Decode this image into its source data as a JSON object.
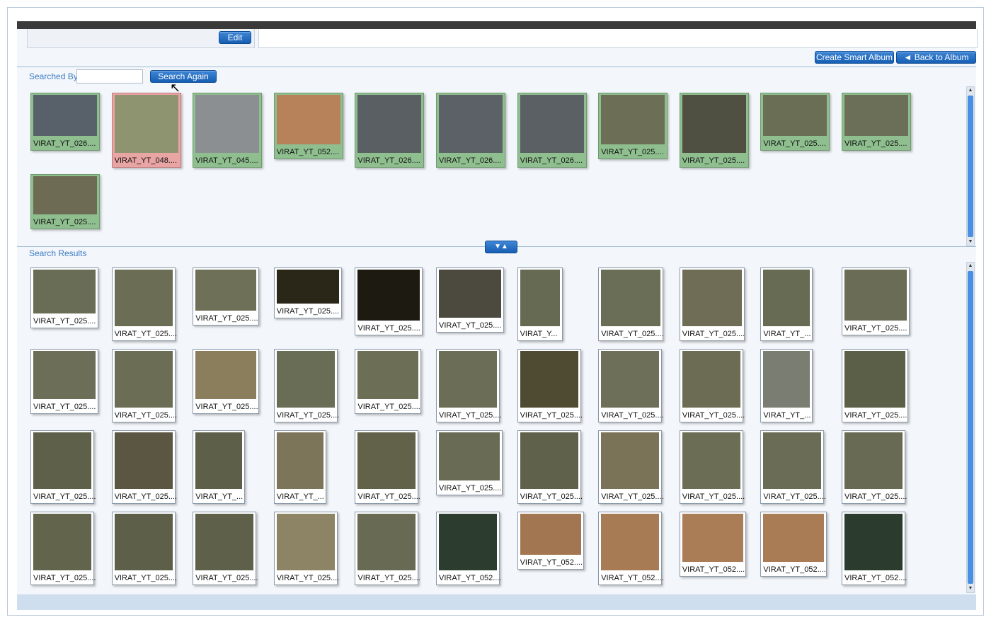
{
  "toolbar": {
    "edit_label": "Edit",
    "create_smart_album": "Create Smart Album",
    "back_to_album": "◄ Back to Album"
  },
  "search": {
    "searched_by_label": "Searched By",
    "searched_by_value": "",
    "search_again_label": "Search Again"
  },
  "query_tiles": [
    {
      "caption": "VIRAT_YT_026....",
      "style": "green",
      "color": "#58616a"
    },
    {
      "caption": "VIRAT_YT_048....",
      "style": "red",
      "color": "#8e9470"
    },
    {
      "caption": "VIRAT_YT_045....",
      "style": "green",
      "color": "#8b8f92"
    },
    {
      "caption": "VIRAT_YT_052....",
      "style": "green",
      "color": "#b7825a"
    },
    {
      "caption": "VIRAT_YT_026....",
      "style": "green",
      "color": "#595f63"
    },
    {
      "caption": "VIRAT_YT_026....",
      "style": "green",
      "color": "#5b6166"
    },
    {
      "caption": "VIRAT_YT_026....",
      "style": "green",
      "color": "#5a6063"
    },
    {
      "caption": "VIRAT_YT_025....",
      "style": "green",
      "color": "#6c6e56"
    },
    {
      "caption": "VIRAT_YT_025....",
      "style": "green",
      "color": "#4f5042"
    },
    {
      "caption": "VIRAT_YT_025....",
      "style": "green",
      "color": "#6a6e55"
    },
    {
      "caption": "VIRAT_YT_025....",
      "style": "green",
      "color": "#6b6f57"
    },
    {
      "caption": "VIRAT_YT_025....",
      "style": "green",
      "color": "#6d6b54"
    }
  ],
  "results": {
    "label": "Search Results",
    "rows": [
      [
        {
          "caption": "VIRAT_YT_025....",
          "color": "#6a6d55"
        },
        {
          "caption": "VIRAT_YT_025....",
          "color": "#6b6e55"
        },
        {
          "caption": "VIRAT_YT_025....",
          "color": "#6e7058"
        },
        {
          "caption": "VIRAT_YT_025....",
          "color": "#2a2618"
        },
        {
          "caption": "VIRAT_YT_025....",
          "color": "#1d1a12"
        },
        {
          "caption": "VIRAT_YT_025....",
          "color": "#4c4a3f"
        },
        {
          "caption": "VIRAT_Y...",
          "color": "#676a53"
        },
        {
          "caption": "VIRAT_YT_025....",
          "color": "#6b6e56"
        },
        {
          "caption": "VIRAT_YT_025....",
          "color": "#6f6d55"
        },
        {
          "caption": "VIRAT_YT_...",
          "color": "#676b53"
        },
        {
          "caption": "VIRAT_YT_025....",
          "color": "#6a6c55"
        }
      ],
      [
        {
          "caption": "VIRAT_YT_025....",
          "color": "#6c6e57"
        },
        {
          "caption": "VIRAT_YT_025....",
          "color": "#6b6e55"
        },
        {
          "caption": "VIRAT_YT_025....",
          "color": "#8b7e5c"
        },
        {
          "caption": "VIRAT_YT_025....",
          "color": "#6a6d55"
        },
        {
          "caption": "VIRAT_YT_025....",
          "color": "#6c6e56"
        },
        {
          "caption": "VIRAT_YT_025....",
          "color": "#6b6d56"
        },
        {
          "caption": "VIRAT_YT_025....",
          "color": "#4f4b33"
        },
        {
          "caption": "VIRAT_YT_025....",
          "color": "#6d6f58"
        },
        {
          "caption": "VIRAT_YT_025....",
          "color": "#6c6c55"
        },
        {
          "caption": "VIRAT_YT_...",
          "color": "#7a7d72"
        },
        {
          "caption": "VIRAT_YT_025....",
          "color": "#5c5f47"
        }
      ],
      [
        {
          "caption": "VIRAT_YT_025....",
          "color": "#5f6049"
        },
        {
          "caption": "VIRAT_YT_025....",
          "color": "#5a5641"
        },
        {
          "caption": "VIRAT_YT_...",
          "color": "#5d5f48"
        },
        {
          "caption": "VIRAT_YT_...",
          "color": "#7d7559"
        },
        {
          "caption": "VIRAT_YT_025....",
          "color": "#616249"
        },
        {
          "caption": "VIRAT_YT_025....",
          "color": "#6a6b55"
        },
        {
          "caption": "VIRAT_YT_025....",
          "color": "#60614a"
        },
        {
          "caption": "VIRAT_YT_025....",
          "color": "#7a7357"
        },
        {
          "caption": "VIRAT_YT_025....",
          "color": "#6b6d55"
        },
        {
          "caption": "VIRAT_YT_025....",
          "color": "#6b6c55"
        },
        {
          "caption": "VIRAT_YT_025....",
          "color": "#686a54"
        }
      ],
      [
        {
          "caption": "VIRAT_YT_025....",
          "color": "#62644c"
        },
        {
          "caption": "VIRAT_YT_025....",
          "color": "#5e5f48"
        },
        {
          "caption": "VIRAT_YT_025....",
          "color": "#5f6049"
        },
        {
          "caption": "VIRAT_YT_025....",
          "color": "#8c8464"
        },
        {
          "caption": "VIRAT_YT_025....",
          "color": "#686a53"
        },
        {
          "caption": "VIRAT_YT_052....",
          "color": "#2c3d2f"
        },
        {
          "caption": "VIRAT_YT_052....",
          "color": "#a27650"
        },
        {
          "caption": "VIRAT_YT_052....",
          "color": "#a77c55"
        },
        {
          "caption": "VIRAT_YT_052....",
          "color": "#aa7d57"
        },
        {
          "caption": "VIRAT_YT_052....",
          "color": "#a97c55"
        },
        {
          "caption": "VIRAT_YT_052....",
          "color": "#2b3c2e"
        }
      ]
    ]
  }
}
